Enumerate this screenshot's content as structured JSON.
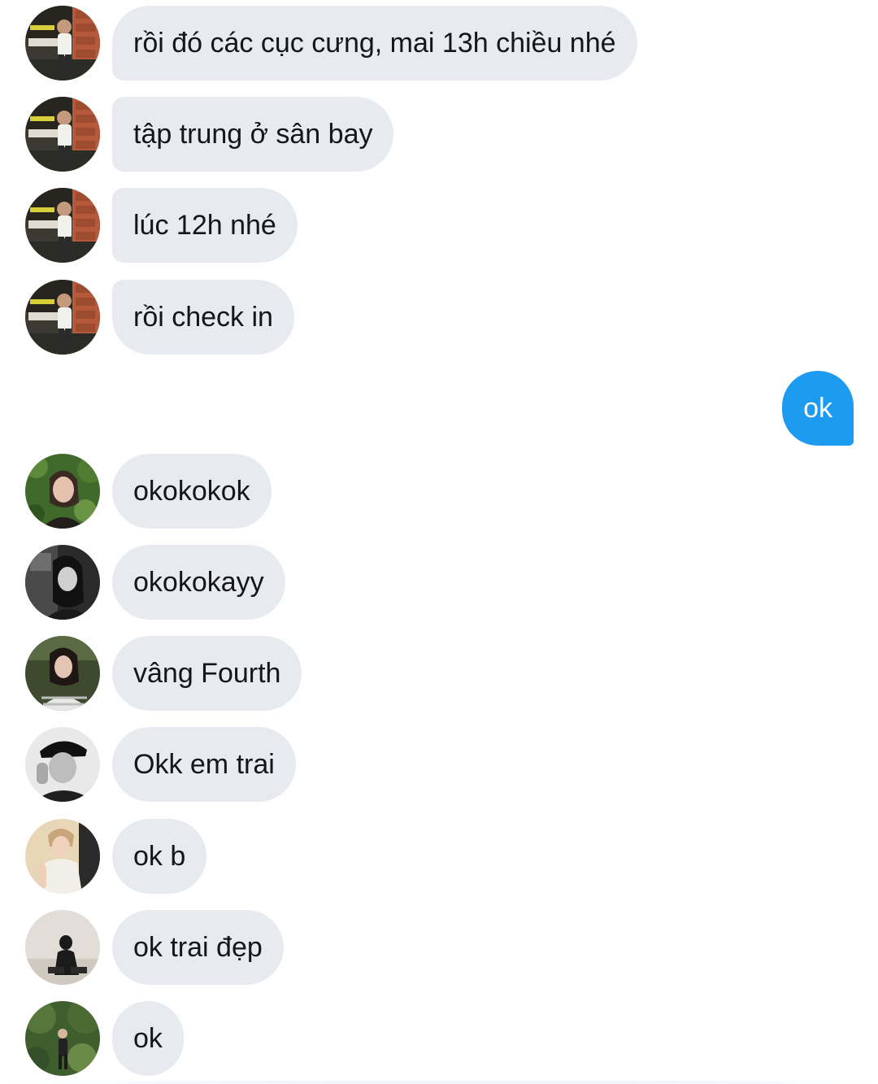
{
  "messages": [
    {
      "sender": "avatar-a",
      "text": "rồi đó các cục cưng, mai 13h chiều nhé"
    },
    {
      "sender": "avatar-a",
      "text": "tập trung ở sân bay"
    },
    {
      "sender": "avatar-a",
      "text": "lúc 12h nhé"
    },
    {
      "sender": "avatar-a",
      "text": "rồi check in"
    },
    {
      "sender": "me",
      "text": "ok"
    },
    {
      "sender": "avatar-b",
      "text": "okokokok"
    },
    {
      "sender": "avatar-c",
      "text": "okokokayy"
    },
    {
      "sender": "avatar-d",
      "text": "vâng Fourth"
    },
    {
      "sender": "avatar-e",
      "text": "Okk em trai"
    },
    {
      "sender": "avatar-f",
      "text": "ok b"
    },
    {
      "sender": "avatar-g",
      "text": "ok trai đẹp"
    },
    {
      "sender": "avatar-h",
      "text": "ok"
    }
  ],
  "colors": {
    "incoming_bubble": "#e7ebef",
    "outgoing_bubble": "#1d9bf0",
    "text": "#141619"
  }
}
